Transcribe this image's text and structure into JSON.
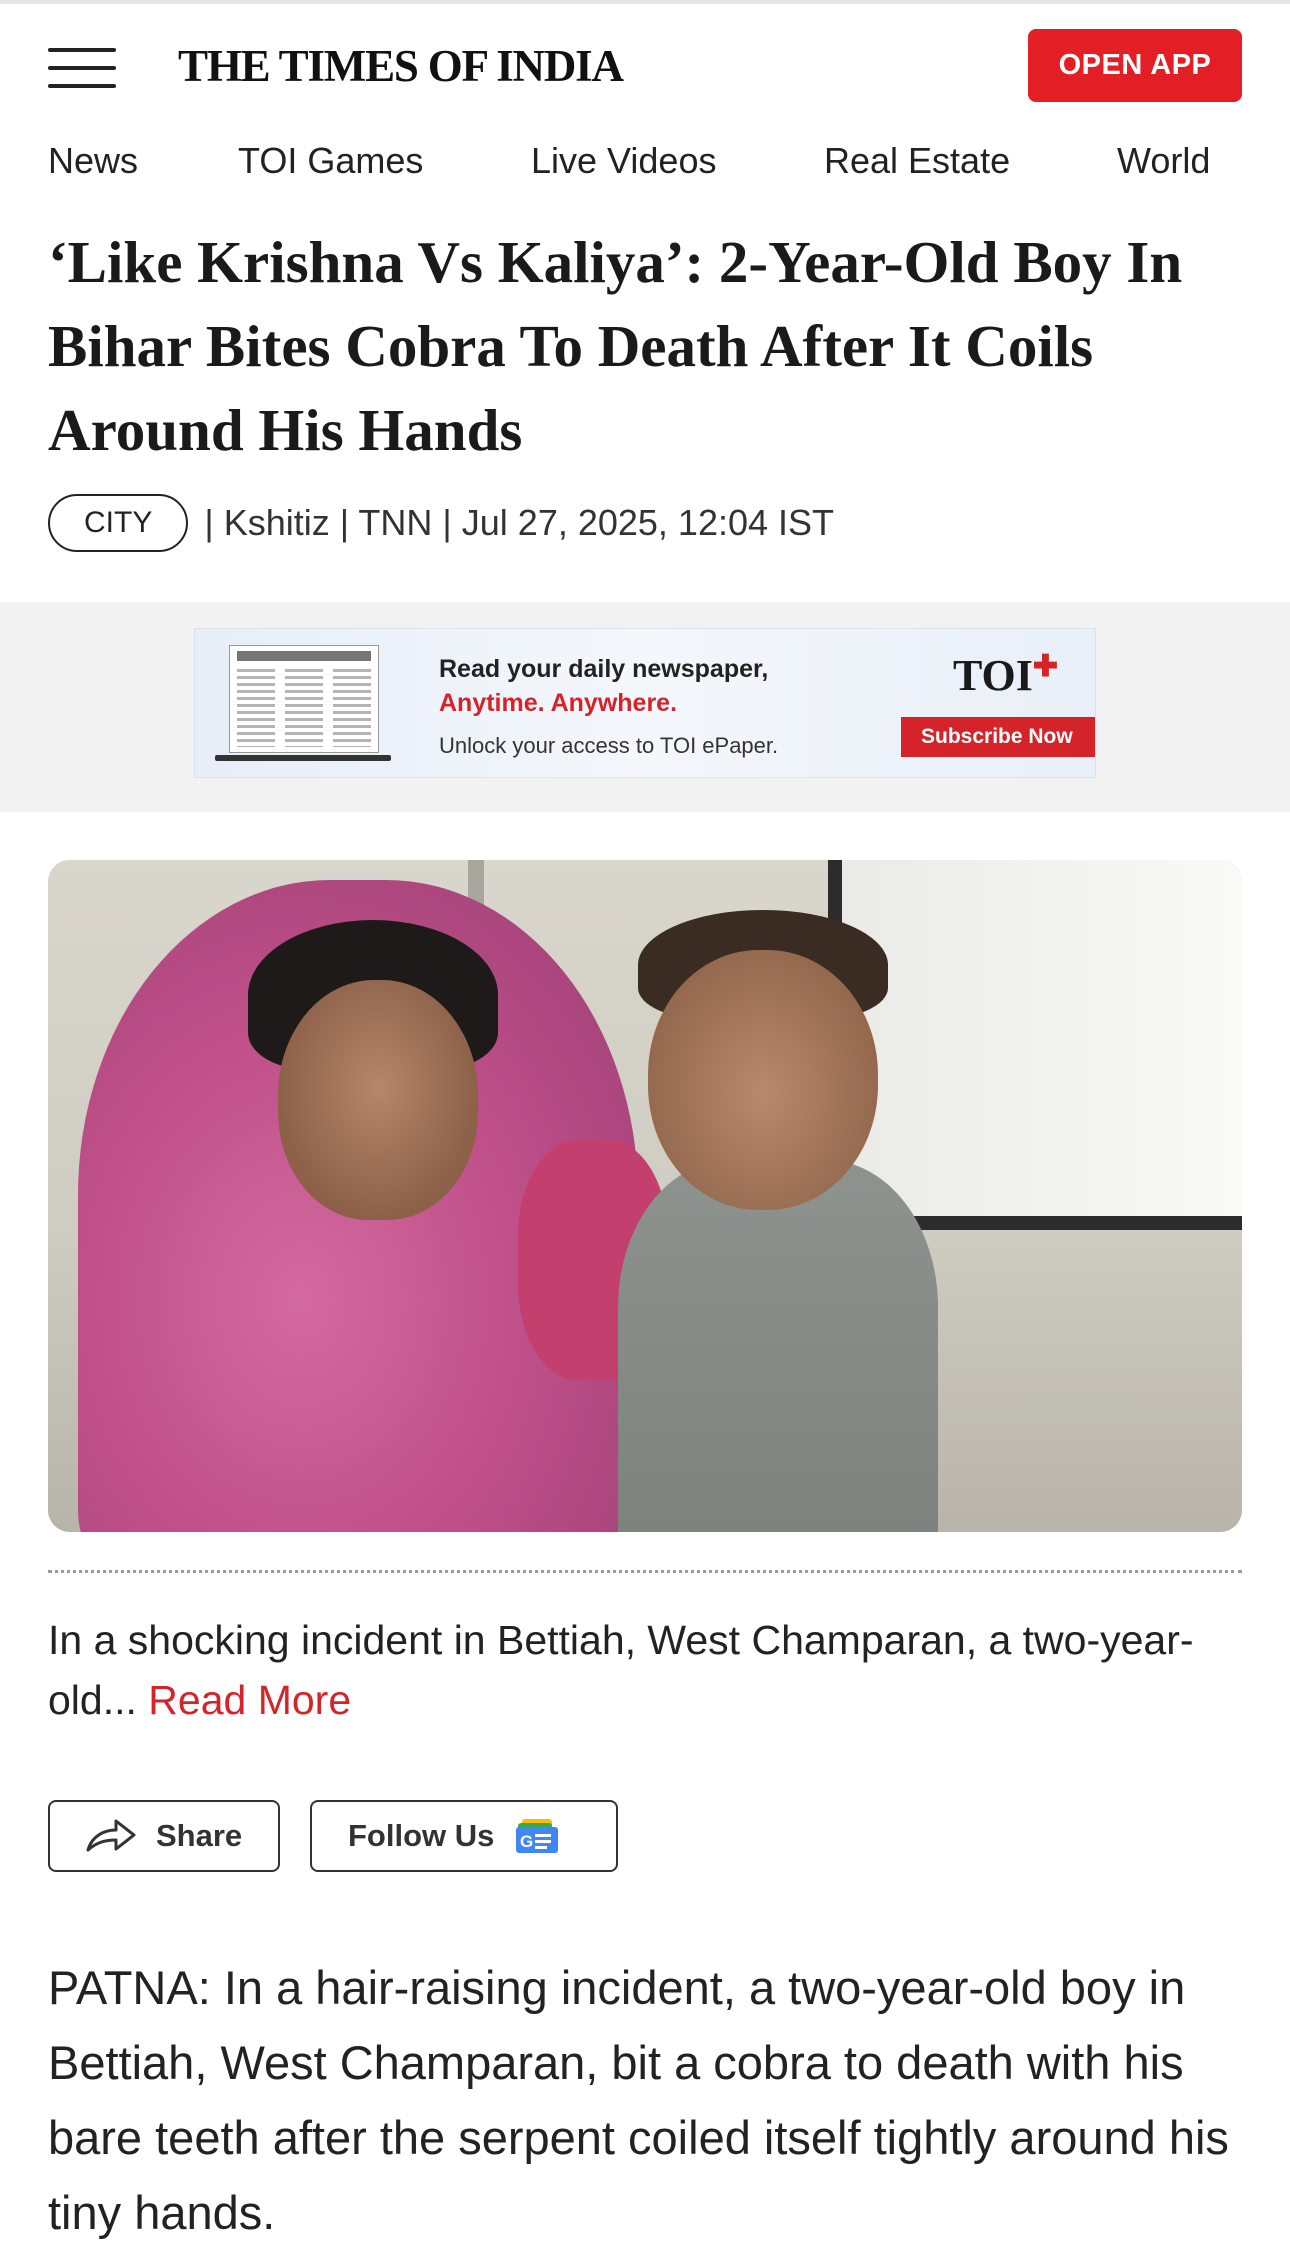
{
  "header": {
    "logo_text": "THE TIMES OF INDIA",
    "open_app_label": "OPEN APP"
  },
  "nav": {
    "items": [
      {
        "label": "News"
      },
      {
        "label": "TOI Games"
      },
      {
        "label": "Live Videos"
      },
      {
        "label": "Real Estate"
      },
      {
        "label": "World"
      }
    ]
  },
  "article": {
    "headline": "‘Like Krishna Vs Kaliya’: 2-Year-Old Boy In Bihar Bites Cobra To Death After It Coils Around His Hands",
    "category_tag": "CITY",
    "meta": "| Kshitiz | TNN | Jul 27, 2025, 12:04 IST",
    "summary": "In a shocking incident in Bettiah, West Champaran, a two-year-old...",
    "read_more_label": "Read More",
    "share_label": "Share",
    "follow_label": "Follow Us",
    "body": "PATNA: In a hair-raising incident, a two-year-old boy in Bettiah, West Champaran, bit a cobra to death with his bare teeth after the serpent coiled itself tightly around his tiny hands."
  },
  "ad": {
    "line1": "Read your daily newspaper,",
    "line2": "Anytime. Anywhere.",
    "line3": "Unlock your access to TOI ePaper.",
    "brand": "TOI",
    "brand_mark": "✚",
    "cta": "Subscribe Now"
  },
  "colors": {
    "accent_red": "#e31e24",
    "text": "#1a1a1a"
  },
  "icons": [
    "hamburger-menu-icon",
    "share-arrow-icon",
    "google-news-icon"
  ]
}
